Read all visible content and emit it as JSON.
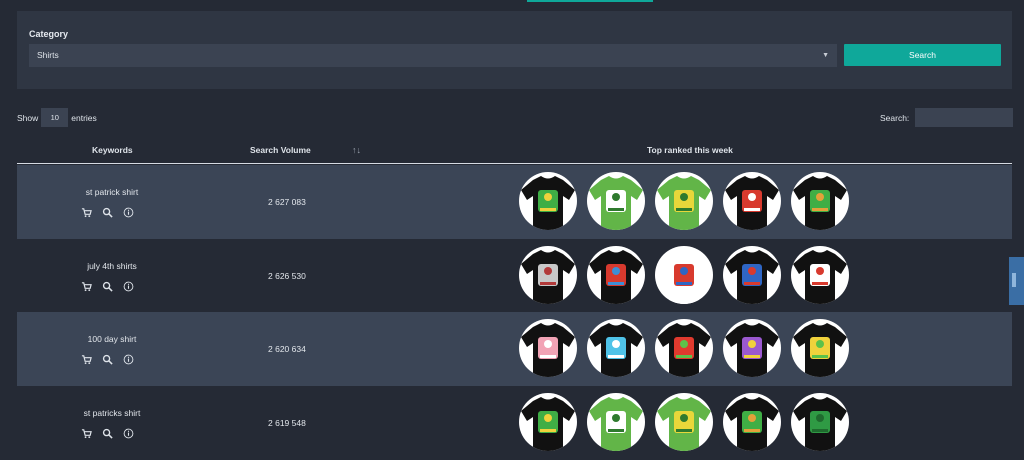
{
  "filter": {
    "category_label": "Category",
    "category_value": "Shirts",
    "search_button": "Search"
  },
  "table_controls": {
    "show_prefix": "Show",
    "entries_value": "10",
    "show_suffix": "entries",
    "search_label": "Search:",
    "search_value": ""
  },
  "columns": {
    "keywords": "Keywords",
    "volume": "Search Volume",
    "sort_glyph": "↑↓",
    "top_ranked": "Top ranked this week"
  },
  "row_icons": [
    "cart-icon",
    "search-icon",
    "info-icon"
  ],
  "rows": [
    {
      "keyword": "st patrick shirt",
      "volume": "2 627 083",
      "shirts": [
        {
          "color": "#111111",
          "art": "#3fae45",
          "accent": "#f0d23c"
        },
        {
          "color": "#62b548",
          "art": "#ffffff",
          "accent": "#2f7a2e"
        },
        {
          "color": "#62b548",
          "art": "#e8d73a",
          "accent": "#2f7a2e"
        },
        {
          "color": "#111111",
          "art": "#d83a2e",
          "accent": "#ffffff"
        },
        {
          "color": "#111111",
          "art": "#3fae45",
          "accent": "#e3a13a"
        }
      ]
    },
    {
      "keyword": "july 4th shirts",
      "volume": "2 626 530",
      "shirts": [
        {
          "color": "#111111",
          "art": "#c8c8c8",
          "accent": "#b23a3a"
        },
        {
          "color": "#111111",
          "art": "#d83a2e",
          "accent": "#3d8fd6"
        },
        {
          "color": "#ffffff",
          "art": "#d83a2e",
          "accent": "#2f66c4"
        },
        {
          "color": "#111111",
          "art": "#2f66c4",
          "accent": "#d83a2e"
        },
        {
          "color": "#111111",
          "art": "#ffffff",
          "accent": "#d83a2e"
        }
      ]
    },
    {
      "keyword": "100 day shirt",
      "volume": "2 620 634",
      "shirts": [
        {
          "color": "#111111",
          "art": "#f2a3b5",
          "accent": "#ffffff"
        },
        {
          "color": "#111111",
          "art": "#4fc3e8",
          "accent": "#ffffff"
        },
        {
          "color": "#111111",
          "art": "#e03a2e",
          "accent": "#5dc14a"
        },
        {
          "color": "#111111",
          "art": "#9b59d0",
          "accent": "#f0d23c"
        },
        {
          "color": "#111111",
          "art": "#f0d23c",
          "accent": "#5dc14a"
        }
      ]
    },
    {
      "keyword": "st patricks shirt",
      "volume": "2 619 548",
      "shirts": [
        {
          "color": "#111111",
          "art": "#3fae45",
          "accent": "#f0d23c"
        },
        {
          "color": "#62b548",
          "art": "#ffffff",
          "accent": "#2f7a2e"
        },
        {
          "color": "#62b548",
          "art": "#e8d73a",
          "accent": "#2f7a2e"
        },
        {
          "color": "#111111",
          "art": "#3fae45",
          "accent": "#e3a13a"
        },
        {
          "color": "#111111",
          "art": "#2f9a44",
          "accent": "#1f6a2e"
        }
      ]
    }
  ]
}
